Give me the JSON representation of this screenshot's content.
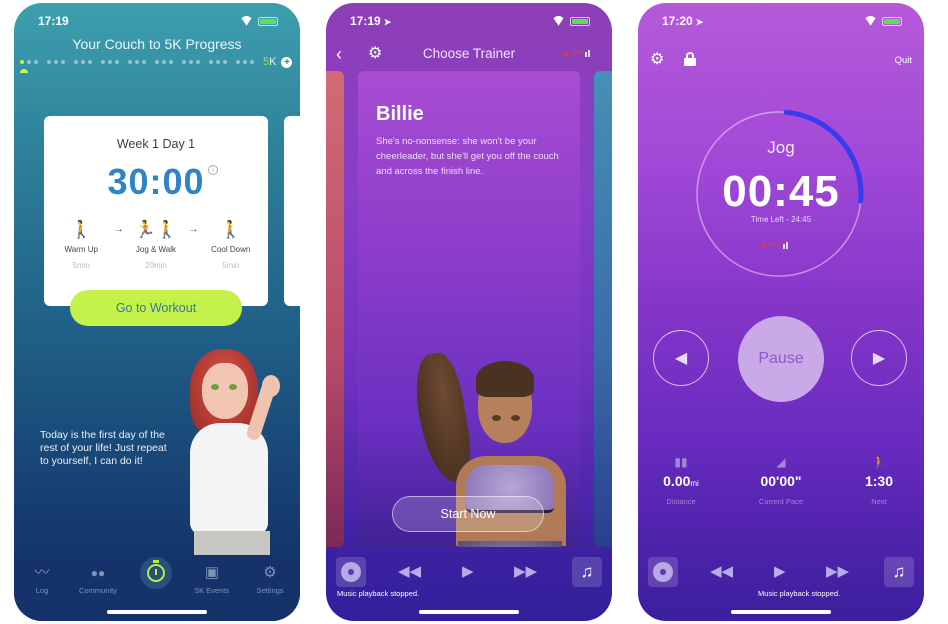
{
  "screens": [
    {
      "status": {
        "time": "17:19"
      },
      "header": {
        "title": "Your Couch to 5K Progress",
        "goal_prefix": "5",
        "goal_suffix": "K"
      },
      "progress": {
        "total_weeks": 9,
        "days_per_week": 3,
        "current_week": 1,
        "current_day": 1
      },
      "workout_card": {
        "title": "Week 1 Day 1",
        "duration": "30:00",
        "phases": [
          {
            "icon": "warm-up-icon",
            "label": "Warm Up",
            "duration": "5min"
          },
          {
            "icon": "jog-walk-icon",
            "label": "Jog & Walk",
            "duration": "20min"
          },
          {
            "icon": "cool-down-icon",
            "label": "Cool Down",
            "duration": "5min"
          }
        ],
        "arrow": "→",
        "cta": "Go to Workout"
      },
      "quote": "Today is the first day of the rest of your life! Just repeat to yourself, I can do it!",
      "colors": {
        "accent": "#c4f24a",
        "time": "#2f84c8",
        "tabbar": "#15336a"
      },
      "tabbar": [
        {
          "label": "Log",
          "icon": "chart-line-icon",
          "glyph": "〰"
        },
        {
          "label": "Community",
          "icon": "people-icon",
          "glyph": "👥"
        },
        {
          "label": "",
          "icon": "stopwatch-icon",
          "active": true
        },
        {
          "label": "5K Events",
          "icon": "calendar-icon",
          "glyph": "▣"
        },
        {
          "label": "Settings",
          "icon": "gear-icon",
          "glyph": "⚙"
        }
      ]
    },
    {
      "status": {
        "time": "17:19"
      },
      "nav": {
        "title": "Choose Trainer",
        "back": "‹",
        "settings": "⚙",
        "gps_label": "GPS"
      },
      "trainer": {
        "name": "Billie",
        "description": "She's no-nonsense: she won't be your cheerleader, but she'll get you off the couch and across the finish line."
      },
      "cta": "Start Now",
      "music": {
        "status": "Music playback stopped.",
        "rewind": "◀◀",
        "play": "▶",
        "forward": "▶▶",
        "playlist": "♫"
      },
      "colors": {
        "card": "#8a3cc9"
      }
    },
    {
      "status": {
        "time": "17:20"
      },
      "toolbar": {
        "settings": "⚙",
        "quit": "Quit"
      },
      "timer": {
        "segment": "Jog",
        "remaining": "00:45",
        "time_left": "Time Left - 24:45",
        "gps_label": "GPS",
        "segment_progress": 0.25
      },
      "controls": {
        "prev": "◀",
        "pause": "Pause",
        "next": "▶"
      },
      "stats": [
        {
          "icon": "binoculars-icon",
          "glyph": "⛶",
          "value": "0.00",
          "unit": "mi",
          "label": "Distance"
        },
        {
          "icon": "shoe-icon",
          "glyph": "👟",
          "value": "00'00\"",
          "unit": "",
          "label": "Current Pace"
        },
        {
          "icon": "walk-icon",
          "glyph": "🚶",
          "value": "1:30",
          "unit": "",
          "label": "Next"
        }
      ],
      "music": {
        "status": "Music playback stopped.",
        "rewind": "◀◀",
        "play": "▶",
        "forward": "▶▶",
        "playlist": "♫"
      },
      "colors": {
        "ring": "#3a3af0",
        "pause": "#c9a9e8"
      }
    }
  ]
}
